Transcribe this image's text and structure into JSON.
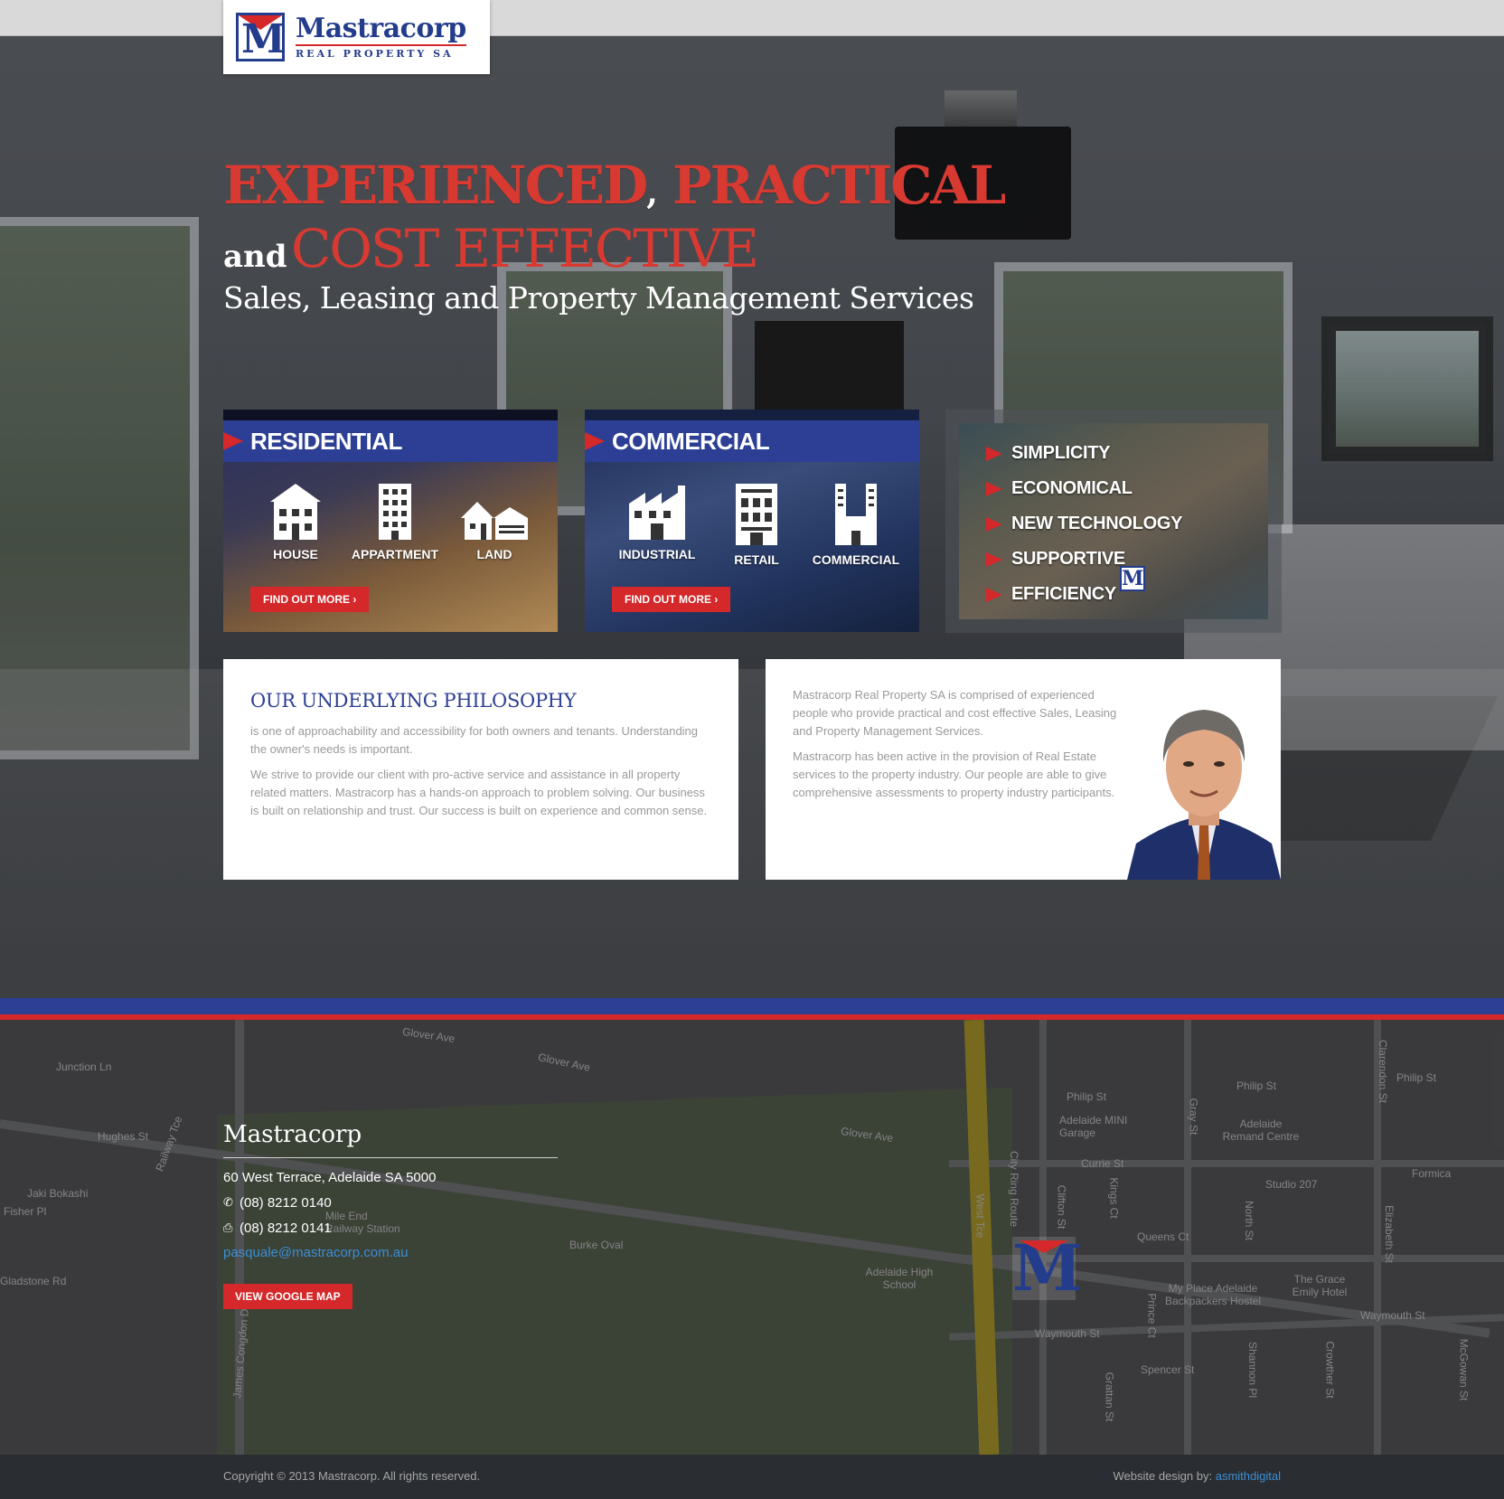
{
  "brand": {
    "name": "Mastracorp",
    "tagline": "REAL PROPERTY SA",
    "mark": "M"
  },
  "hero": {
    "headline_part1": "EXPERIENCED",
    "headline_comma": ",",
    "headline_part2": "PRACTICAL",
    "headline_and": "and",
    "headline_part3": "COST EFFECTIVE",
    "subheadline": "Sales, Leasing and Property Management Services"
  },
  "panels": {
    "residential": {
      "title": "RESIDENTIAL",
      "items": [
        {
          "label": "HOUSE",
          "icon": "house-icon"
        },
        {
          "label": "APPARTMENT",
          "icon": "apartment-icon"
        },
        {
          "label": "LAND",
          "icon": "land-icon"
        }
      ],
      "button": "FIND OUT MORE"
    },
    "commercial": {
      "title": "COMMERCIAL",
      "items": [
        {
          "label": "INDUSTRIAL",
          "icon": "factory-icon"
        },
        {
          "label": "RETAIL",
          "icon": "retail-icon"
        },
        {
          "label": "COMMERCIAL",
          "icon": "office-tower-icon"
        }
      ],
      "button": "FIND OUT MORE"
    }
  },
  "values": [
    "SIMPLICITY",
    "ECONOMICAL",
    "NEW TECHNOLOGY",
    "SUPPORTIVE",
    "EFFICIENCY"
  ],
  "philosophy": {
    "title": "OUR UNDERLYING PHILOSOPHY",
    "p1": "is one of approachability and accessibility for both owners and tenants. Understanding the owner's needs is important.",
    "p2": "We strive to provide our client with pro-active service and assistance in all property related matters. Mastracorp has a hands-on approach to problem solving. Our business is built on relationship and trust. Our success is built on experience and common sense."
  },
  "about": {
    "p1": "Mastracorp Real Property SA is comprised of experienced people who provide practical and cost effective Sales, Leasing and Property Management Services.",
    "p2": "Mastracorp has been active in the provision of Real Estate services to the property industry. Our people are able to give comprehensive assessments to property industry participants."
  },
  "map": {
    "labels": [
      "Glover Ave",
      "Glover Ave",
      "Glover Ave",
      "Junction Ln",
      "Hughes St",
      "Jaki Bokashi",
      "Fisher Pl",
      "Gladstone Rd",
      "James Congdon Dr",
      "Railway Tce",
      "Mile End Railway Station",
      "Burke Oval",
      "Adelaide High School",
      "Philip St",
      "Philip St",
      "Philip St",
      "Adelaide MINI Garage",
      "Adelaide Remand Centre",
      "Currie St",
      "Studio 207",
      "Formica",
      "Queens Ct",
      "Kings Ct",
      "Clifton St",
      "West Tce",
      "City Ring Route",
      "Gray St",
      "North St",
      "Clarendon St",
      "Elizabeth St",
      "Waymouth St",
      "Waymouth St",
      "My Place Adelaide Backpackers Hostel",
      "The Grace Emily Hotel",
      "Spencer St",
      "Prince Ct",
      "Shannon Pl",
      "Grattan St",
      "Crowther St",
      "McGowan St"
    ]
  },
  "contact": {
    "name": "Mastracorp",
    "address": "60 West Terrace, Adelaide SA 5000",
    "phone": "(08) 8212 0140",
    "fax": "(08) 8212 0141",
    "email": "pasquale@mastracorp.com.au",
    "map_button": "VIEW GOOGLE MAP"
  },
  "footer": {
    "copyright": "Copyright © 2013 Mastracorp. All rights reserved.",
    "credit_label": "Website design by:",
    "credit_link": "asmithdigital"
  },
  "colors": {
    "brand_blue": "#2d3f94",
    "brand_red": "#d4282a",
    "link_blue": "#3b8fd6"
  }
}
